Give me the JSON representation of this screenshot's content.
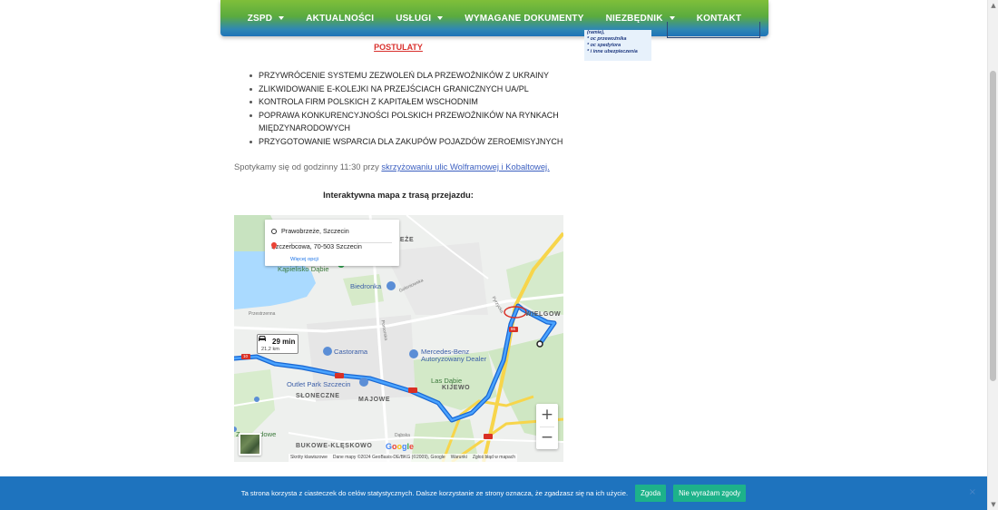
{
  "nav": {
    "items": [
      {
        "label": "ZSPD",
        "dropdown": true
      },
      {
        "label": "AKTUALNOŚCI",
        "dropdown": false
      },
      {
        "label": "USŁUGI",
        "dropdown": true
      },
      {
        "label": "WYMAGANE DOKUMENTY",
        "dropdown": false
      },
      {
        "label": "NIEZBĘDNIK",
        "dropdown": true
      },
      {
        "label": "KONTAKT",
        "dropdown": false
      }
    ]
  },
  "sidebar": {
    "ad_lines": [
      "(ramie),",
      "* oc przewoźnika",
      "* oc spedytora",
      "* i inne ubezpieczenia"
    ]
  },
  "main": {
    "heading": "POSTULATY",
    "postulates": [
      "PRZYWRÓCENIE SYSTEMU ZEZWOLEŃ DLA PRZEWOŹNIKÓW Z UKRAINY",
      "ZLIKWIDOWANIE E-KOLEJKI NA PRZEJŚCIACH GRANICZNYCH UA/PL",
      "KONTROLA FIRM POLSKICH Z KAPITAŁEM WSCHODNIM",
      "POPRAWA KONKURENCYJNOŚCI POLSKICH PRZEWOŹNIKÓW NA RYNKACH MIĘDZYNARODOWYCH",
      "PRZYGOTOWANIE WSPARCIA DLA ZAKUPÓW POJAZDÓW ZEROEMISYJNYCH"
    ],
    "meeting_text": "Spotykamy się od godzinny 11:30 przy ",
    "meeting_link": "skrzyżowaniu ulic Wolframowej i Kobaltowej.",
    "map_title": "Interaktywna mapa z trasą przejazdu:"
  },
  "map": {
    "origin": "Prawobrzeże, Szczecin",
    "destination": "Szczerbcowa, 70-503 Szczecin",
    "more_options": "Więcej opcji",
    "duration": "29 min",
    "distance": "21,2 km",
    "labels": {
      "zeze": "ZEŻE",
      "kapielisko": "Kąpielisko Dąbie",
      "biedronka": "Biedronka",
      "golenowska": "Goleniowska",
      "przestrzenna": "Przestrzenna",
      "pomorska": "Pomorska",
      "wielgow": "WIELGOW",
      "castorama": "Castorama",
      "mercedes": "Mercedes-Benz Autoryzowany Dealer",
      "outlet": "Outlet Park Szczecin",
      "las_dabie": "Las Dąbie",
      "kijewo": "KIJEWO",
      "slonecznie": "SŁONECZNE",
      "majowe": "MAJOWE",
      "zmaragdowe": "Zmaragdowe",
      "bukowe": "BUKOWE-KLĘSKOWO",
      "dabska": "Dąbska",
      "krzywa": "Pyrzycka",
      "road_10": "10",
      "road_86": "86"
    },
    "zoom_in": "+",
    "zoom_out": "−",
    "footer": {
      "shortcuts": "Skróty klawiszowe",
      "data": "Dane mapy ©2024 GeoBasis-DE/BKG (©2009), Google",
      "terms": "Warunki",
      "report": "Zgłoś błąd w mapach"
    }
  },
  "cookie": {
    "text": "Ta strona korzysta z ciasteczek do celów statystycznych. Dalsze korzystanie ze strony oznacza, że zgadzasz się na ich użycie.",
    "accept": "Zgoda",
    "decline": "Nie wyrażam zgody",
    "close": "×"
  },
  "colors": {
    "nav_top": "#7fbf3a",
    "nav_bottom": "#1f73b8",
    "heading_red": "#d9302c",
    "link_blue": "#3b5fc0",
    "route_blue": "#1a73e8",
    "cookie_bg": "#1e73be",
    "cookie_btn": "#1db28a"
  }
}
